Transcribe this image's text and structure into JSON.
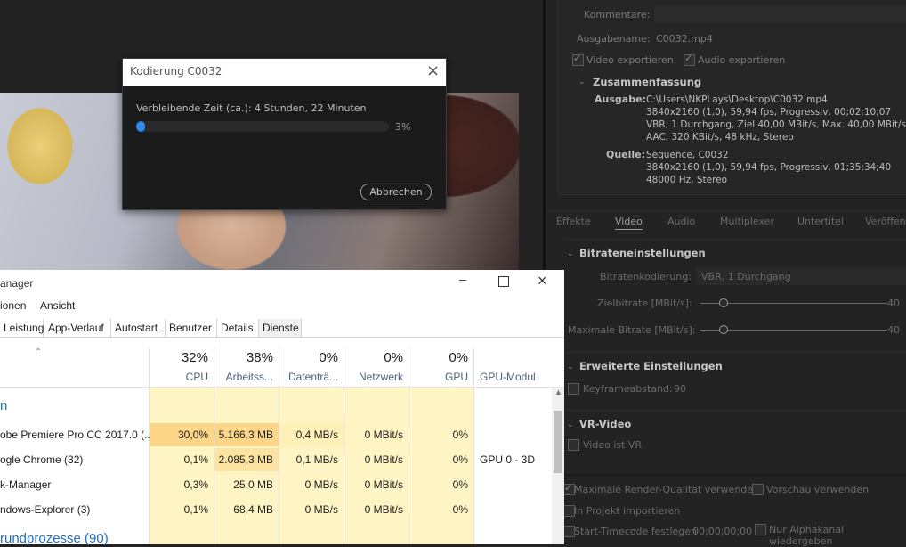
{
  "export_settings": {
    "comment_label": "Kommentare:",
    "output_name_label": "Ausgabename:",
    "output_name_value": "C0032.mp4",
    "export_video_label": "Video exportieren",
    "export_audio_label": "Audio exportieren",
    "summary_title": "Zusammenfassung",
    "output_label": "Ausgabe:",
    "output_lines": [
      "C:\\Users\\NKPLays\\Desktop\\C0032.mp4",
      "3840x2160 (1,0), 59,94 fps, Progressiv, 00;02;10;07",
      "VBR, 1 Durchgang, Ziel 40,00 MBit/s, Max. 40,00 MBit/s",
      "AAC, 320 KBit/s, 48 kHz, Stereo"
    ],
    "source_label": "Quelle:",
    "source_lines": [
      "Sequence, C0032",
      "3840x2160 (1,0), 59,94 fps, Progressiv, 01;35;34;40",
      "48000 Hz, Stereo"
    ],
    "tabs": [
      "Effekte",
      "Video",
      "Audio",
      "Multiplexer",
      "Untertitel",
      "Veröffen"
    ],
    "active_tab": "Video",
    "bitrate_title": "Bitrateneinstellungen",
    "bitrate_encoding_label": "Bitratenkodierung:",
    "bitrate_encoding_value": "VBR, 1 Durchgang",
    "target_bitrate_label": "Zielbitrate [MBit/s]:",
    "target_bitrate_value": "40",
    "max_bitrate_label": "Maximale Bitrate [MBit/s]:",
    "max_bitrate_value": "40",
    "advanced_title": "Erweiterte Einstellungen",
    "keyframe_label": "Keyframeabstand:",
    "keyframe_value": "90",
    "vr_title": "VR-Video",
    "vr_label": "Video ist VR",
    "max_render_label": "Maximale Render-Qualität verwenden",
    "preview_label": "Vorschau verwenden",
    "import_project_label": "In Projekt importieren",
    "start_timecode_label": "Start-Timecode festlegen",
    "start_timecode_value": "00;00;00;00",
    "alpha_label": "Nur Alphakanal wiedergeben"
  },
  "encoding_dialog": {
    "title": "Kodierung C0032",
    "remaining_text": "Verbleibende Zeit (ca.): 4 Stunden, 22 Minuten",
    "progress_label": "3%",
    "progress": 0.03,
    "cancel_label": "Abbrechen"
  },
  "task_manager": {
    "title": "anager",
    "menu": [
      "ionen",
      "Ansicht"
    ],
    "tabs": [
      "Leistung",
      "App-Verlauf",
      "Autostart",
      "Benutzer",
      "Details",
      "Dienste"
    ],
    "columns": [
      {
        "pct": "32%",
        "name": "CPU"
      },
      {
        "pct": "38%",
        "name": "Arbeitss..."
      },
      {
        "pct": "0%",
        "name": "Datenträ..."
      },
      {
        "pct": "0%",
        "name": "Netzwerk"
      },
      {
        "pct": "0%",
        "name": "GPU"
      },
      {
        "pct": "",
        "name": "GPU-Modul"
      }
    ],
    "rows": [
      {
        "name": "obe Premiere Pro CC 2017.0 (...",
        "cpu": "30,0%",
        "mem": "5.166,3 MB",
        "disk": "0,4 MB/s",
        "net": "0 MBit/s",
        "gpu": "0%",
        "gpu_engine": ""
      },
      {
        "name": "ogle Chrome (32)",
        "cpu": "0,1%",
        "mem": "2.085,3 MB",
        "disk": "0,1 MB/s",
        "net": "0 MBit/s",
        "gpu": "0%",
        "gpu_engine": "GPU 0 - 3D"
      },
      {
        "name": "k-Manager",
        "cpu": "0,3%",
        "mem": "25,0 MB",
        "disk": "0 MB/s",
        "net": "0 MBit/s",
        "gpu": "0%",
        "gpu_engine": ""
      },
      {
        "name": "ndows-Explorer (3)",
        "cpu": "0,1%",
        "mem": "68,4 MB",
        "disk": "0 MB/s",
        "net": "0 MBit/s",
        "gpu": "0%",
        "gpu_engine": ""
      }
    ],
    "group_apps": "n",
    "group_background": "rundprozesse (90)"
  },
  "colors": {
    "dark_bg": "#232323",
    "accent_blue": "#2d8ceb",
    "cpu_highlight": "#fcd589",
    "cell_yellow": "#fff4c4",
    "tm_link_blue": "#1f6fc7"
  }
}
